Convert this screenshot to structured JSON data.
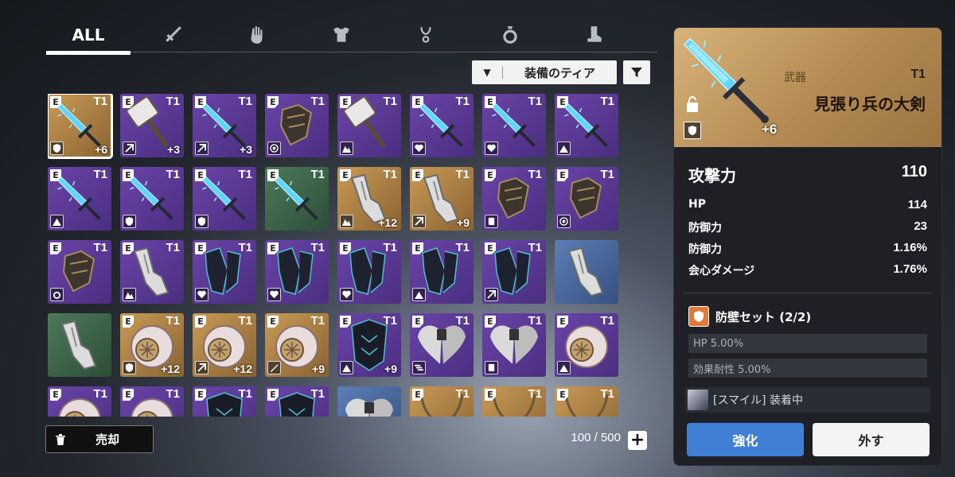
{
  "tabs": [
    {
      "label": "ALL",
      "icon": "all",
      "active": true
    },
    {
      "label": "",
      "icon": "sword-icon"
    },
    {
      "label": "",
      "icon": "glove-icon"
    },
    {
      "label": "",
      "icon": "armor-icon"
    },
    {
      "label": "",
      "icon": "necklace-icon"
    },
    {
      "label": "",
      "icon": "ring-icon"
    },
    {
      "label": "",
      "icon": "boots-icon"
    }
  ],
  "filter": {
    "label": "装備のティア"
  },
  "items": [
    {
      "rarity": "gold",
      "type": "sword",
      "tier": "T1",
      "set": "shield",
      "plus": "+6",
      "selected": true
    },
    {
      "rarity": "purple",
      "type": "hammer",
      "tier": "T1",
      "set": "pierce",
      "plus": "+3"
    },
    {
      "rarity": "purple",
      "type": "sword",
      "tier": "T1",
      "set": "pierce",
      "plus": "+3"
    },
    {
      "rarity": "purple",
      "type": "gauntlet",
      "tier": "T1",
      "set": "target",
      "plus": ""
    },
    {
      "rarity": "purple",
      "type": "hammer",
      "tier": "T1",
      "set": "crit",
      "plus": ""
    },
    {
      "rarity": "purple",
      "type": "sword",
      "tier": "T1",
      "set": "heart",
      "plus": ""
    },
    {
      "rarity": "purple",
      "type": "sword",
      "tier": "T1",
      "set": "heart",
      "plus": ""
    },
    {
      "rarity": "purple",
      "type": "sword",
      "tier": "T1",
      "set": "up",
      "plus": ""
    },
    {
      "rarity": "purple",
      "type": "sword",
      "tier": "T1",
      "set": "up",
      "plus": ""
    },
    {
      "rarity": "purple",
      "type": "sword",
      "tier": "T1",
      "set": "shield",
      "plus": ""
    },
    {
      "rarity": "purple",
      "type": "sword",
      "tier": "T1",
      "set": "shield",
      "plus": ""
    },
    {
      "rarity": "green",
      "type": "sword",
      "tier": "T1",
      "set": "",
      "plus": ""
    },
    {
      "rarity": "gold",
      "type": "glove",
      "tier": "T1",
      "set": "crit",
      "plus": "+12"
    },
    {
      "rarity": "gold",
      "type": "glove",
      "tier": "T1",
      "set": "pierce",
      "plus": "+9"
    },
    {
      "rarity": "purple",
      "type": "gauntlet",
      "tier": "T1",
      "set": "guard",
      "plus": ""
    },
    {
      "rarity": "purple",
      "type": "gauntlet",
      "tier": "T1",
      "set": "target",
      "plus": ""
    },
    {
      "rarity": "purple",
      "type": "gauntlet",
      "tier": "T1",
      "set": "ring",
      "plus": ""
    },
    {
      "rarity": "purple",
      "type": "glove",
      "tier": "T1",
      "set": "crit",
      "plus": ""
    },
    {
      "rarity": "purple",
      "type": "darkglove",
      "tier": "T1",
      "set": "heart",
      "plus": ""
    },
    {
      "rarity": "purple",
      "type": "darkglove",
      "tier": "T1",
      "set": "heart",
      "plus": ""
    },
    {
      "rarity": "purple",
      "type": "darkglove",
      "tier": "T1",
      "set": "heart",
      "plus": ""
    },
    {
      "rarity": "purple",
      "type": "darkglove",
      "tier": "T1",
      "set": "up",
      "plus": ""
    },
    {
      "rarity": "purple",
      "type": "darkglove",
      "tier": "T1",
      "set": "pierce",
      "plus": ""
    },
    {
      "rarity": "blue",
      "type": "glove",
      "tier": "",
      "set": "",
      "plus": ""
    },
    {
      "rarity": "green",
      "type": "glove",
      "tier": "",
      "set": "",
      "plus": ""
    },
    {
      "rarity": "gold",
      "type": "armor",
      "tier": "T1",
      "set": "shield",
      "plus": "+12"
    },
    {
      "rarity": "gold",
      "type": "armor",
      "tier": "T1",
      "set": "pierce",
      "plus": "+12"
    },
    {
      "rarity": "gold",
      "type": "armor",
      "tier": "T1",
      "set": "sword",
      "plus": "+9"
    },
    {
      "rarity": "purple",
      "type": "darkarmor",
      "tier": "T1",
      "set": "up",
      "plus": "+9"
    },
    {
      "rarity": "purple",
      "type": "wings",
      "tier": "T1",
      "set": "speed",
      "plus": ""
    },
    {
      "rarity": "purple",
      "type": "wings",
      "tier": "T1",
      "set": "guard",
      "plus": ""
    },
    {
      "rarity": "purple",
      "type": "armor",
      "tier": "T1",
      "set": "up",
      "plus": ""
    },
    {
      "rarity": "purple",
      "type": "armor",
      "tier": "T1",
      "set": "",
      "plus": ""
    },
    {
      "rarity": "purple",
      "type": "armor",
      "tier": "T1",
      "set": "",
      "plus": ""
    },
    {
      "rarity": "purple",
      "type": "darkarmor",
      "tier": "T1",
      "set": "",
      "plus": ""
    },
    {
      "rarity": "purple",
      "type": "darkarmor",
      "tier": "T1",
      "set": "",
      "plus": ""
    },
    {
      "rarity": "blue",
      "type": "wings",
      "tier": "",
      "set": "",
      "plus": ""
    },
    {
      "rarity": "gold",
      "type": "neck",
      "tier": "T1",
      "set": "",
      "plus": ""
    },
    {
      "rarity": "gold",
      "type": "neck",
      "tier": "T1",
      "set": "",
      "plus": ""
    },
    {
      "rarity": "gold",
      "type": "neck",
      "tier": "T1",
      "set": "",
      "plus": ""
    }
  ],
  "sell": {
    "label": "売却"
  },
  "capacity": "100 / 500",
  "detail": {
    "category": "武器",
    "tier": "T1",
    "name": "見張り兵の大剣",
    "plus": "+6",
    "main_stat": {
      "label": "攻撃力",
      "value": "110"
    },
    "sub_stats": [
      {
        "label": "HP",
        "value": "114"
      },
      {
        "label": "防御力",
        "value": "23"
      },
      {
        "label": "防御力",
        "value": "1.16%"
      },
      {
        "label": "会心ダメージ",
        "value": "1.76%"
      }
    ],
    "set_name": "防壁セット (2/2)",
    "set_effects": [
      "HP 5.00%",
      "効果耐性 5.00%"
    ],
    "equipped": "[スマイル] 装着中",
    "enhance_label": "強化",
    "unequip_label": "外す"
  },
  "colors": {
    "accent_blue": "#3f7fd6",
    "gold": "#c89a55",
    "purple": "#5a3896"
  }
}
